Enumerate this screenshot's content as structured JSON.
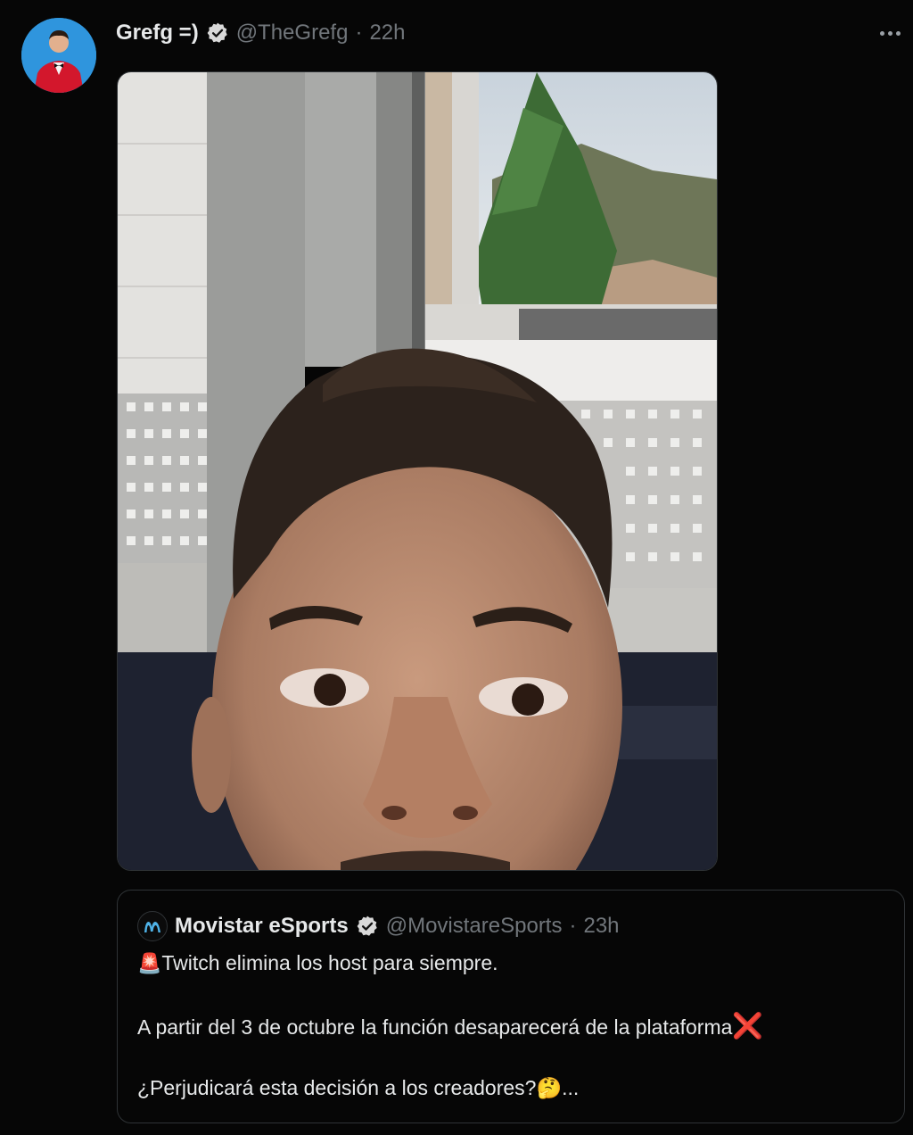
{
  "author": {
    "display_name": "Grefg =)",
    "handle": "@TheGrefg",
    "separator": "·",
    "time": "22h"
  },
  "quoted": {
    "display_name": "Movistar eSports",
    "handle": "@MovistareSports",
    "separator": "·",
    "time": "23h",
    "line1_emoji": "🚨",
    "line1": "Twitch elimina los host para siempre.",
    "line2": "A partir del 3 de octubre la función desaparecerá de la plataforma",
    "line2_emoji": "❌",
    "line3": "¿Perjudicará esta decisión a los creadores?",
    "line3_emoji": "🤔",
    "line3_suffix": "..."
  },
  "icons": {
    "verified": "verified-badge-icon",
    "more": "more-options-icon",
    "quoted_logo": "movistar-logo-icon"
  },
  "colors": {
    "background": "#060606",
    "text": "#e7e9ea",
    "secondary": "#71767b",
    "border": "#2f3336",
    "movistar_blue": "#4fb3e8"
  }
}
